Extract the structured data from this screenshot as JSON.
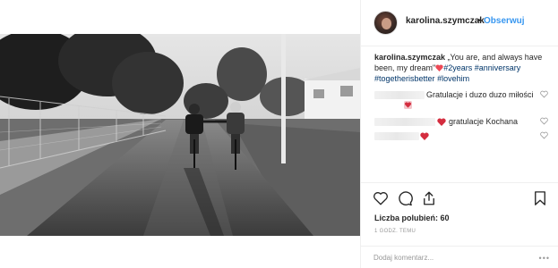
{
  "post": {
    "username": "karolina.szymczak",
    "separator": "•",
    "follow_label": "Obserwuj",
    "photo_icon": "black-white-photo-two-cyclists-on-path"
  },
  "caption": {
    "username": "karolina.szymczak",
    "text_before": "„You are, and always have been, my dream\"",
    "emoji": "red-heart-emoji",
    "hashtags": [
      "#2years",
      "#anniversary",
      "#togetherisbetter",
      "#lovehim"
    ]
  },
  "comments": [
    {
      "text": "Gratulacje i duzo duzo miłości",
      "emoji": "heart-emoji-boxed"
    },
    {
      "text": "gratulacje Kochana",
      "emoji": "red-heart-emoji"
    },
    {
      "text": "",
      "emoji": "red-heart-emoji"
    }
  ],
  "actions": {
    "icons": [
      "heart-outline-icon",
      "comment-bubble-icon",
      "share-icon",
      "bookmark-icon"
    ]
  },
  "likes_text": "Liczba polubień: 60",
  "timestamp": "1 GODZ. TEMU",
  "add_comment_placeholder": "Dodaj komentarz...",
  "more_dots": "•••",
  "colors": {
    "follow": "#3897f0",
    "hashtag": "#003569",
    "heart": "#ed4956",
    "muted": "#999999"
  }
}
